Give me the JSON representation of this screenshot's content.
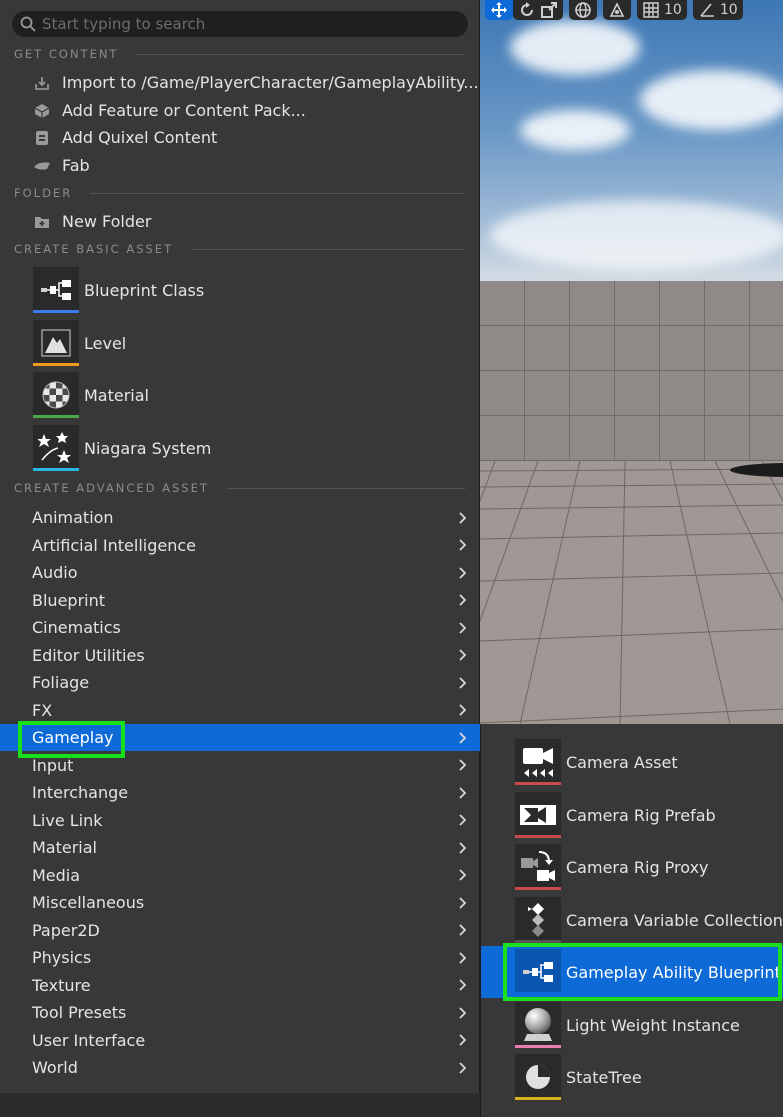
{
  "search": {
    "placeholder": "Start typing to search"
  },
  "viewport_toolbar": {
    "grid_snap": "10",
    "angle_snap": "10"
  },
  "sections": {
    "get_content": "GET CONTENT",
    "folder": "FOLDER",
    "create_basic": "CREATE BASIC ASSET",
    "create_advanced": "CREATE ADVANCED ASSET"
  },
  "get_content_items": [
    {
      "label": "Import to /Game/PlayerCharacter/GameplayAbility...",
      "icon": "import-icon"
    },
    {
      "label": "Add Feature or Content Pack...",
      "icon": "content-pack-icon"
    },
    {
      "label": "Add Quixel Content",
      "icon": "quixel-icon"
    },
    {
      "label": "Fab",
      "icon": "fab-icon"
    }
  ],
  "folder_items": [
    {
      "label": "New Folder",
      "icon": "new-folder-icon"
    }
  ],
  "basic_assets": [
    {
      "label": "Blueprint Class",
      "icon": "blueprint-class-icon",
      "color": "#3c7cf0"
    },
    {
      "label": "Level",
      "icon": "level-icon",
      "color": "#f09a1e"
    },
    {
      "label": "Material",
      "icon": "material-icon",
      "color": "#4aa84a"
    },
    {
      "label": "Niagara System",
      "icon": "niagara-icon",
      "color": "#27b7e6"
    }
  ],
  "advanced_categories": [
    "Animation",
    "Artificial Intelligence",
    "Audio",
    "Blueprint",
    "Cinematics",
    "Editor Utilities",
    "Foliage",
    "FX",
    "Gameplay",
    "Input",
    "Interchange",
    "Live Link",
    "Material",
    "Media",
    "Miscellaneous",
    "Paper2D",
    "Physics",
    "Texture",
    "Tool Presets",
    "User Interface",
    "World"
  ],
  "selected_category": "Gameplay",
  "gameplay_submenu": [
    {
      "label": "Camera Asset",
      "icon": "camera-asset-icon",
      "color": "#c84a4a"
    },
    {
      "label": "Camera Rig Prefab",
      "icon": "camera-rig-prefab-icon",
      "color": "#c84a4a"
    },
    {
      "label": "Camera Rig Proxy",
      "icon": "camera-rig-proxy-icon",
      "color": "#c84a4a"
    },
    {
      "label": "Camera Variable Collection",
      "icon": "camera-variable-collection-icon",
      "color": "#555555"
    },
    {
      "label": "Gameplay Ability Blueprint",
      "icon": "gameplay-ability-blueprint-icon",
      "color": "#0e6ad6"
    },
    {
      "label": "Light Weight Instance",
      "icon": "light-weight-instance-icon",
      "color": "#e77fb0"
    },
    {
      "label": "StateTree",
      "icon": "statetree-icon",
      "color": "#d6b21e"
    }
  ],
  "selected_submenu_item": "Gameplay Ability Blueprint",
  "highlight_color": "#19e01b",
  "selection_color": "#0e6ad6"
}
